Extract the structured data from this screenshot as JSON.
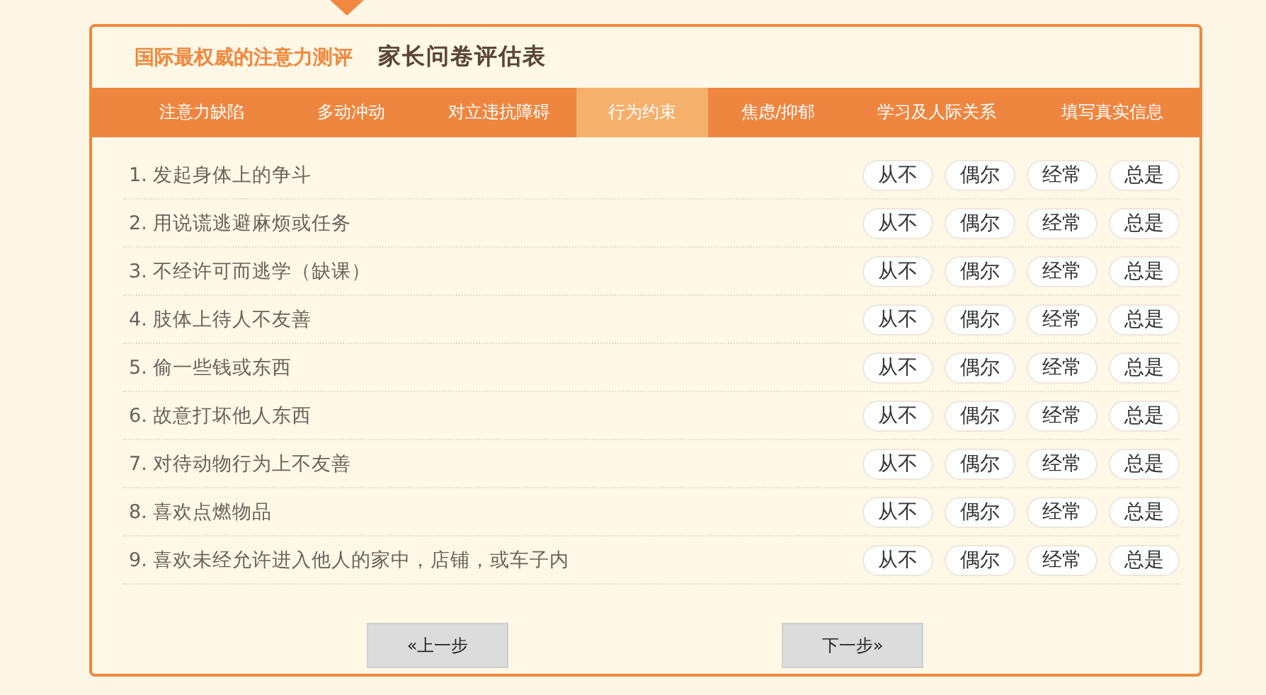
{
  "header": {
    "brand": "国际最权威的注意力测评",
    "title": "家长问卷评估表"
  },
  "tabs": [
    {
      "label": "注意力缺陷",
      "selected": false
    },
    {
      "label": "多动冲动",
      "selected": false
    },
    {
      "label": "对立违抗障碍",
      "selected": false
    },
    {
      "label": "行为约束",
      "selected": true
    },
    {
      "label": "焦虑/抑郁",
      "selected": false
    },
    {
      "label": "学习及人际关系",
      "selected": false
    },
    {
      "label": "填写真实信息",
      "selected": false
    }
  ],
  "questions": [
    {
      "text": "1. 发起身体上的争斗",
      "options": [
        {
          "label": "从不",
          "selected": false
        },
        {
          "label": "偶尔",
          "selected": false
        },
        {
          "label": "经常",
          "selected": false
        },
        {
          "label": "总是",
          "selected": false
        }
      ]
    },
    {
      "text": "2. 用说谎逃避麻烦或任务",
      "options": [
        {
          "label": "从不",
          "selected": false
        },
        {
          "label": "偶尔",
          "selected": false
        },
        {
          "label": "经常",
          "selected": false
        },
        {
          "label": "总是",
          "selected": false
        }
      ]
    },
    {
      "text": "3. 不经许可而逃学（缺课）",
      "options": [
        {
          "label": "从不",
          "selected": false
        },
        {
          "label": "偶尔",
          "selected": false
        },
        {
          "label": "经常",
          "selected": false
        },
        {
          "label": "总是",
          "selected": false
        }
      ]
    },
    {
      "text": "4. 肢体上待人不友善",
      "options": [
        {
          "label": "从不",
          "selected": false
        },
        {
          "label": "偶尔",
          "selected": false
        },
        {
          "label": "经常",
          "selected": false
        },
        {
          "label": "总是",
          "selected": false
        }
      ]
    },
    {
      "text": "5. 偷一些钱或东西",
      "options": [
        {
          "label": "从不",
          "selected": false
        },
        {
          "label": "偶尔",
          "selected": false
        },
        {
          "label": "经常",
          "selected": false
        },
        {
          "label": "总是",
          "selected": false
        }
      ]
    },
    {
      "text": "6. 故意打坏他人东西",
      "options": [
        {
          "label": "从不",
          "selected": false
        },
        {
          "label": "偶尔",
          "selected": false
        },
        {
          "label": "经常",
          "selected": false
        },
        {
          "label": "总是",
          "selected": false
        }
      ]
    },
    {
      "text": "7. 对待动物行为上不友善",
      "options": [
        {
          "label": "从不",
          "selected": false
        },
        {
          "label": "偶尔",
          "selected": false
        },
        {
          "label": "经常",
          "selected": false
        },
        {
          "label": "总是",
          "selected": false
        }
      ]
    },
    {
      "text": "8. 喜欢点燃物品",
      "options": [
        {
          "label": "从不",
          "selected": false
        },
        {
          "label": "偶尔",
          "selected": false
        },
        {
          "label": "经常",
          "selected": false
        },
        {
          "label": "总是",
          "selected": false
        }
      ]
    },
    {
      "text": "9. 喜欢未经允许进入他人的家中，店铺，或车子内",
      "options": [
        {
          "label": "从不",
          "selected": false
        },
        {
          "label": "偶尔",
          "selected": false
        },
        {
          "label": "经常",
          "selected": false
        },
        {
          "label": "总是",
          "selected": false
        }
      ]
    }
  ],
  "buttons": [
    {
      "label": "«上一步"
    },
    {
      "label": "下一步»"
    }
  ]
}
